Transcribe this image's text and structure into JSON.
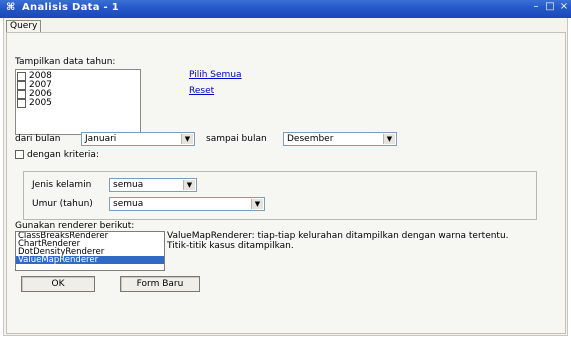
{
  "window": {
    "title": "Analisis Data - 1",
    "controls": {
      "minimize": "–",
      "maximize": "□",
      "close": "×"
    }
  },
  "tab": {
    "label": "Query"
  },
  "year_section": {
    "label": "Tampilkan data tahun:",
    "years": [
      "2008",
      "2007",
      "2006",
      "2005"
    ],
    "select_all": "Pilih Semua",
    "reset": "Reset"
  },
  "month_range": {
    "from_label": "dari bulan",
    "from_value": "Januari",
    "to_label": "sampai bulan",
    "to_value": "Desember"
  },
  "criteria": {
    "checkbox_label": "dengan kriteria:",
    "checked": false,
    "gender_label": "Jenis kelamin",
    "gender_value": "semua",
    "age_label": "Umur (tahun)",
    "age_value": "semua"
  },
  "renderer": {
    "label": "Gunakan renderer berikut:",
    "items": [
      "ClassBreaksRenderer",
      "ChartRenderer",
      "DotDensityRenderer",
      "ValueMapRenderer"
    ],
    "selected_index": 3,
    "description": "ValueMapRenderer: tiap-tiap kelurahan ditampilkan dengan warna tertentu. Titik-titik kasus ditampilkan."
  },
  "buttons": {
    "ok": "OK",
    "new_form": "Form Baru"
  },
  "colors": {
    "titlebar": "#2457c7",
    "selection": "#316ac5",
    "link": "#0000cc"
  }
}
